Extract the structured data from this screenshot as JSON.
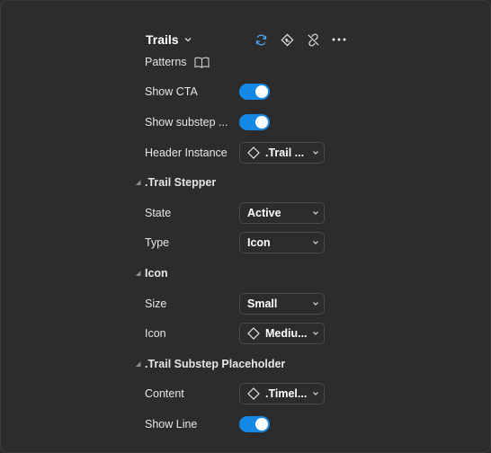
{
  "panel": {
    "title": "Trails",
    "subtitle": "Patterns"
  },
  "props": {
    "show_cta": {
      "label": "Show CTA",
      "on": true
    },
    "show_substep": {
      "label": "Show substep ...",
      "on": true
    },
    "header_instance": {
      "label": "Header Instance",
      "value": ".Trail ..."
    },
    "trail_stepper": {
      "title": ".Trail Stepper"
    },
    "state": {
      "label": "State",
      "value": "Active"
    },
    "type": {
      "label": "Type",
      "value": "Icon"
    },
    "icon_section": {
      "title": "Icon"
    },
    "size": {
      "label": "Size",
      "value": "Small"
    },
    "icon": {
      "label": "Icon",
      "value": "Mediu..."
    },
    "substep_placeholder": {
      "title": ".Trail Substep Placeholder"
    },
    "content": {
      "label": "Content",
      "value": ".Timel..."
    },
    "show_line": {
      "label": "Show Line",
      "on": true
    }
  },
  "colors": {
    "accent": "#1488e6",
    "icon_blue": "#4aa3f0",
    "background": "#2c2c2c"
  },
  "icons": [
    "chevron-down-icon",
    "sync-icon",
    "go-to-main-icon",
    "detach-icon",
    "more-icon",
    "book-icon",
    "instance-diamond-icon"
  ]
}
